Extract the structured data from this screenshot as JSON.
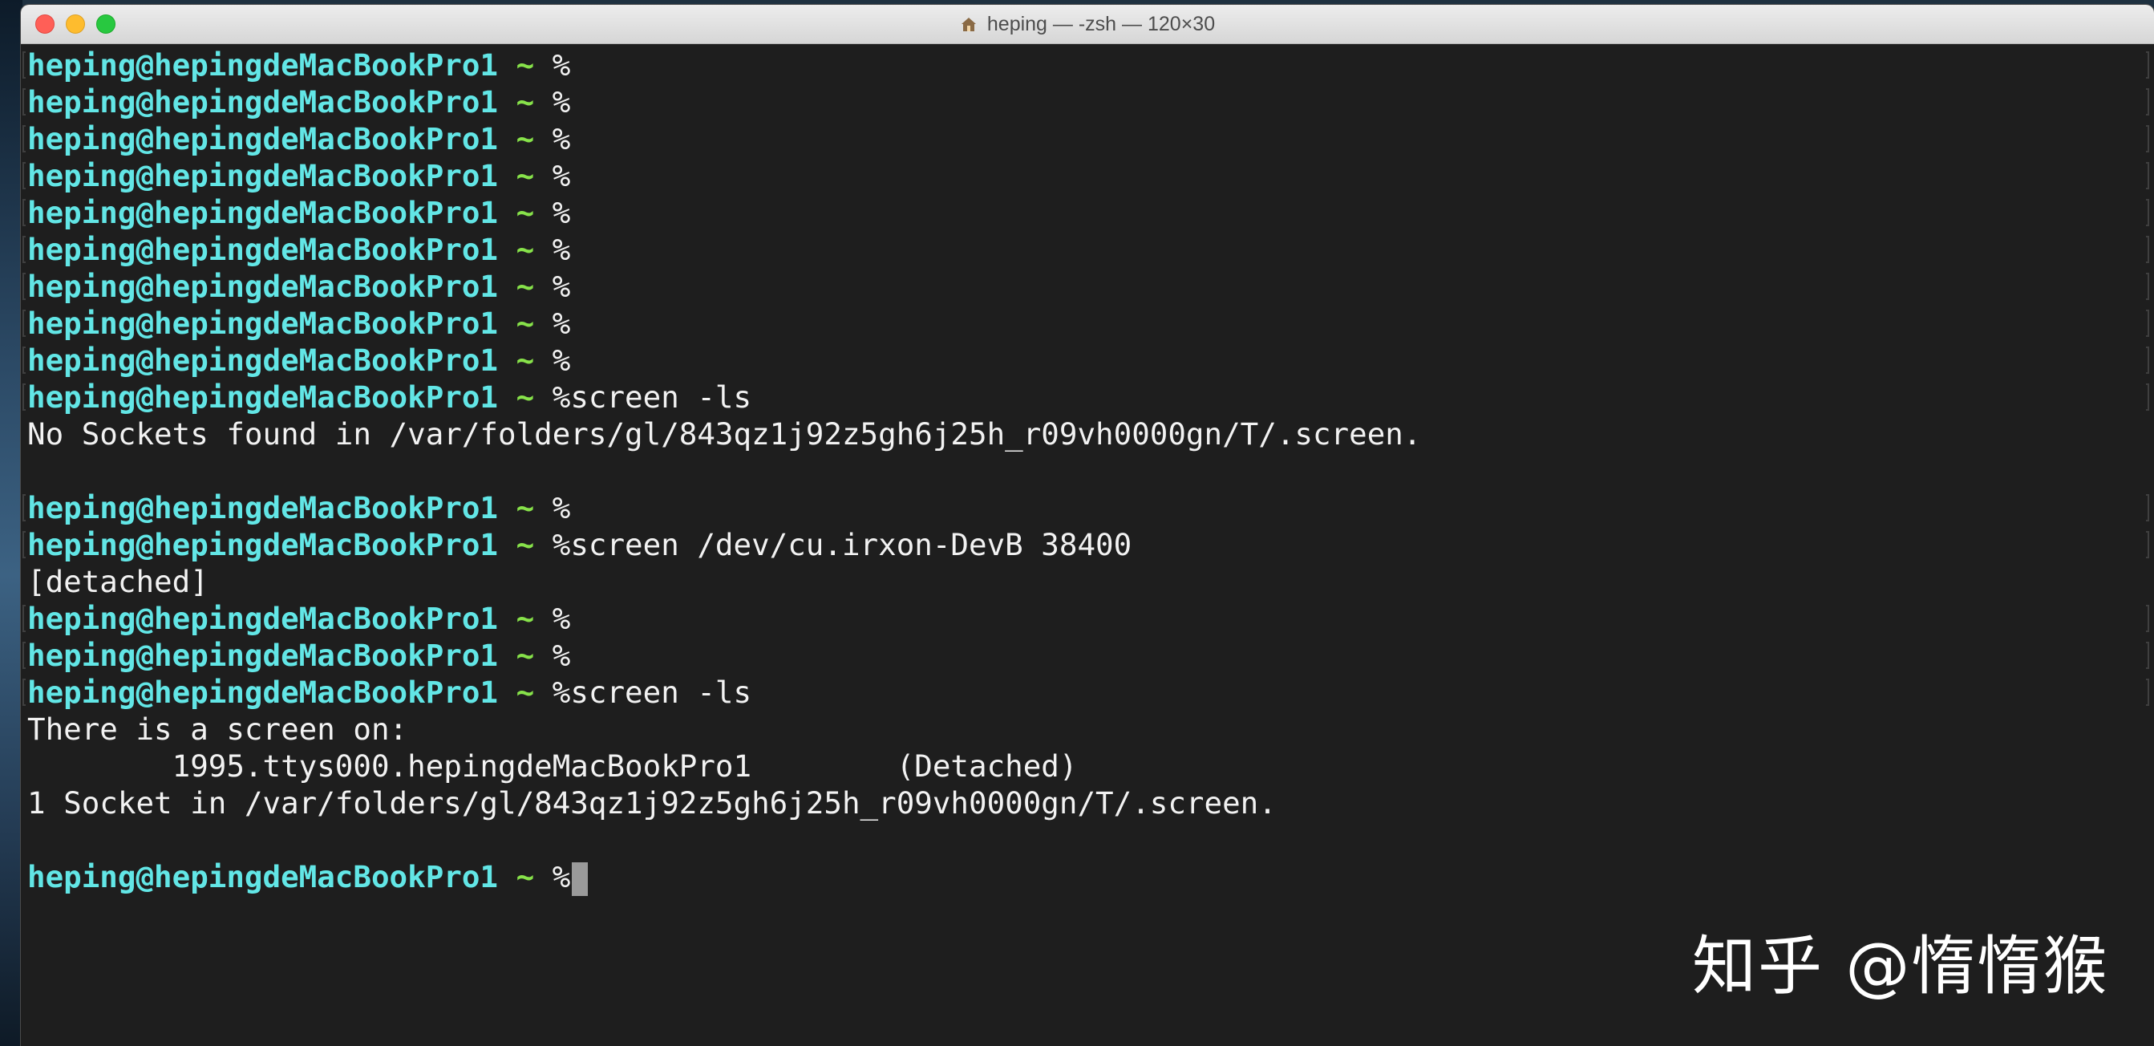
{
  "window": {
    "title": "heping — -zsh — 120×30"
  },
  "icons": {
    "title_icon": "home-folder-icon"
  },
  "colors": {
    "user": "#62e6e6",
    "tilde": "#87e24a",
    "text": "#f2f2f2",
    "background": "#1e1e1e"
  },
  "prompt": {
    "user": "heping@hepingdeMacBookPro1",
    "tilde": "~",
    "symbol": "%"
  },
  "lines": [
    {
      "type": "prompt",
      "cmd": ""
    },
    {
      "type": "prompt",
      "cmd": ""
    },
    {
      "type": "prompt",
      "cmd": ""
    },
    {
      "type": "prompt",
      "cmd": ""
    },
    {
      "type": "prompt",
      "cmd": ""
    },
    {
      "type": "prompt",
      "cmd": ""
    },
    {
      "type": "prompt",
      "cmd": ""
    },
    {
      "type": "prompt",
      "cmd": ""
    },
    {
      "type": "prompt",
      "cmd": ""
    },
    {
      "type": "prompt",
      "cmd": "screen -ls"
    },
    {
      "type": "output",
      "text": "No Sockets found in /var/folders/gl/843qz1j92z5gh6j25h_r09vh0000gn/T/.screen."
    },
    {
      "type": "blank",
      "text": ""
    },
    {
      "type": "prompt",
      "cmd": ""
    },
    {
      "type": "prompt",
      "cmd": "screen /dev/cu.irxon-DevB 38400"
    },
    {
      "type": "output",
      "text": "[detached]"
    },
    {
      "type": "prompt",
      "cmd": ""
    },
    {
      "type": "prompt",
      "cmd": ""
    },
    {
      "type": "prompt",
      "cmd": "screen -ls"
    },
    {
      "type": "output",
      "text": "There is a screen on:"
    },
    {
      "type": "output",
      "text": "        1995.ttys000.hepingdeMacBookPro1        (Detached)"
    },
    {
      "type": "output",
      "text": "1 Socket in /var/folders/gl/843qz1j92z5gh6j25h_r09vh0000gn/T/.screen."
    },
    {
      "type": "blank",
      "text": ""
    },
    {
      "type": "active",
      "cmd": ""
    }
  ],
  "watermark": "知乎 @惰惰猴"
}
